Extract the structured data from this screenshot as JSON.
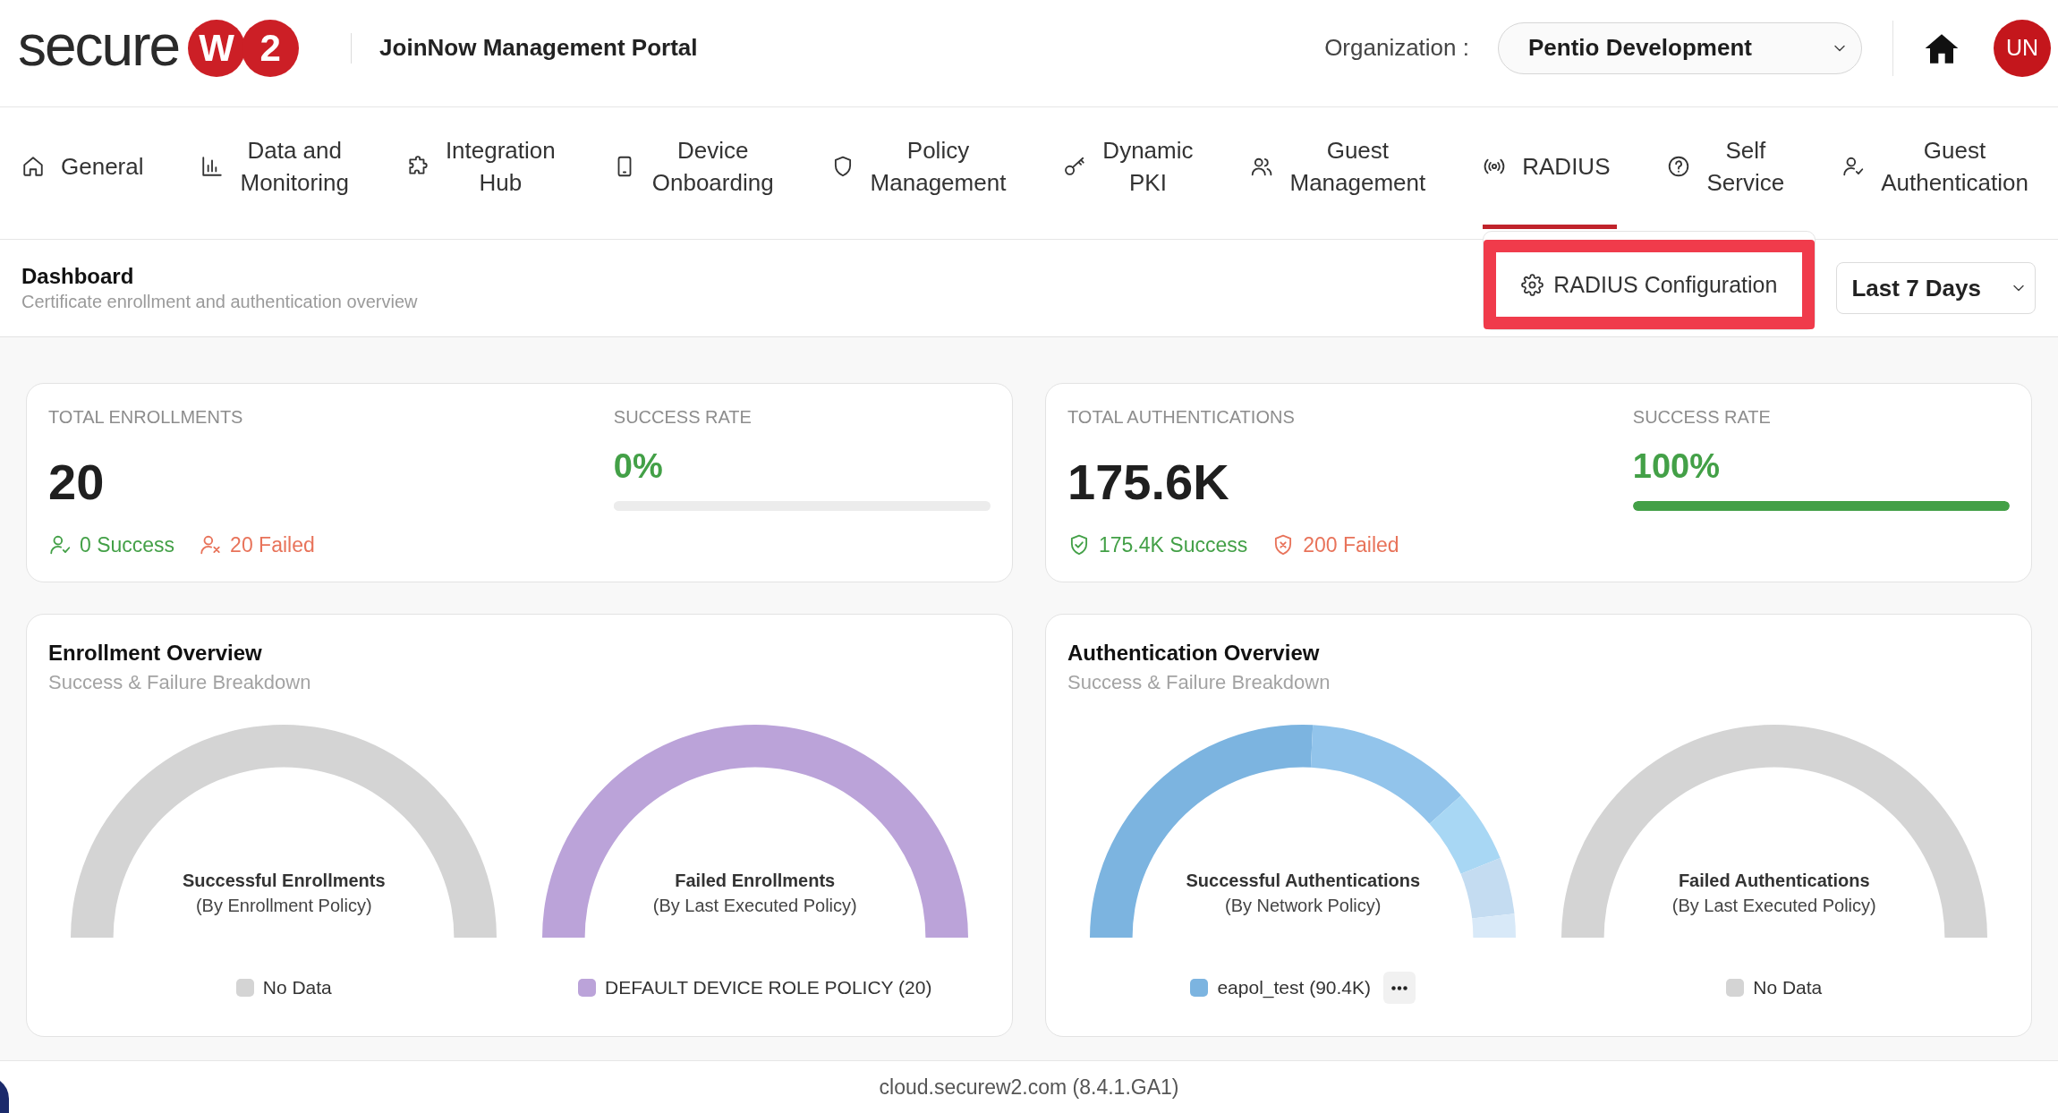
{
  "header": {
    "logo": {
      "text": "secure",
      "emblems": [
        "W",
        "2"
      ]
    },
    "title": "JoinNow Management Portal",
    "organization_label": "Organization :",
    "organization": "Pentio Development",
    "avatar": "UN"
  },
  "nav": [
    {
      "label": "General",
      "selected": false
    },
    {
      "label": "Data and\nMonitoring",
      "selected": false
    },
    {
      "label": "Integration\nHub",
      "selected": false
    },
    {
      "label": "Device\nOnboarding",
      "selected": false
    },
    {
      "label": "Policy\nManagement",
      "selected": false
    },
    {
      "label": "Dynamic\nPKI",
      "selected": false
    },
    {
      "label": "Guest\nManagement",
      "selected": false
    },
    {
      "label": "RADIUS",
      "selected": true,
      "menu": [
        {
          "label": "RADIUS Configuration",
          "highlighted": true
        }
      ]
    },
    {
      "label": "Self\nService",
      "selected": false
    },
    {
      "label": "Guest\nAuthentication",
      "selected": false
    }
  ],
  "page": {
    "title": "Dashboard",
    "subtitle": "Certificate enrollment and authentication overview",
    "period": "Last 7 Days"
  },
  "stats": [
    {
      "label": "TOTAL ENROLLMENTS",
      "value": "20",
      "success": "0 Success",
      "failed": "20 Failed",
      "rate_label": "SUCCESS RATE",
      "rate": "0%",
      "level": 0
    },
    {
      "label": "TOTAL AUTHENTICATIONS",
      "value": "175.6K",
      "success": "175.4K Success",
      "failed": "200 Failed",
      "rate_label": "SUCCESS RATE",
      "rate": "100%",
      "level": 1
    }
  ],
  "overviews": [
    {
      "title": "Enrollment Overview",
      "subtitle": "Success & Failure Breakdown",
      "gauges": [
        {
          "title": "Successful Enrollments",
          "caption": "(By Enrollment Policy)",
          "kind": "solid",
          "legend": [
            {
              "label": "No Data",
              "color": "#d4d4d4"
            }
          ],
          "more": false
        },
        {
          "title": "Failed Enrollments",
          "caption": "(By Last Executed Policy)",
          "kind": "solid",
          "legend": [
            {
              "label": "DEFAULT DEVICE ROLE POLICY (20)",
              "color": "#bba3d9"
            }
          ],
          "more": false
        }
      ]
    },
    {
      "title": "Authentication Overview",
      "subtitle": "Success & Failure Breakdown",
      "gauges": [
        {
          "title": "Successful Authentications",
          "caption": "(By Network Policy)",
          "kind": "segmented",
          "legend": [
            {
              "label": "eapol_test (90.4K)",
              "color": "#7cb4e0"
            }
          ],
          "more": true
        },
        {
          "title": "Failed Authentications",
          "caption": "(By Last Executed Policy)",
          "kind": "solid",
          "legend": [
            {
              "label": "No Data",
              "color": "#d4d4d4"
            }
          ],
          "more": false
        }
      ]
    }
  ],
  "footer": "cloud.securew2.com (8.4.1.GA1)"
}
